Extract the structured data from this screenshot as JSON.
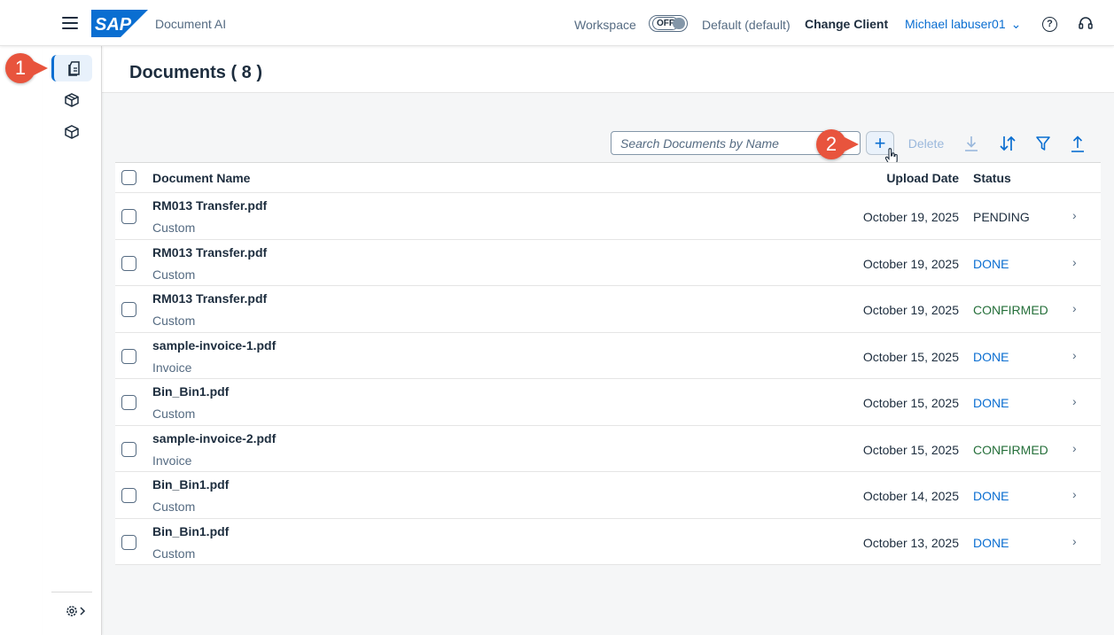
{
  "header": {
    "app_name": "Document AI",
    "workspace_label": "Workspace",
    "workspace_toggle": "OFF",
    "client_default": "Default (default)",
    "change_client": "Change Client",
    "user_name": "Michael labuser01",
    "logo_text": "SAP"
  },
  "sidenav": {
    "items": [
      {
        "name": "documents",
        "icon": "documents-icon",
        "active": true
      },
      {
        "name": "schemas",
        "icon": "cube-icon",
        "active": false
      },
      {
        "name": "templates",
        "icon": "cube-outline-icon",
        "active": false
      }
    ],
    "settings_icon": "gear-icon"
  },
  "page": {
    "title": "Documents ( 8 )"
  },
  "toolbar": {
    "search_placeholder": "Search Documents by Name",
    "add_label": "+",
    "delete_label": "Delete"
  },
  "table": {
    "headers": {
      "name": "Document Name",
      "date": "Upload Date",
      "status": "Status"
    },
    "rows": [
      {
        "name": "RM013 Transfer.pdf",
        "type": "Custom",
        "date": "October 19, 2025",
        "status": "PENDING"
      },
      {
        "name": "RM013 Transfer.pdf",
        "type": "Custom",
        "date": "October 19, 2025",
        "status": "DONE"
      },
      {
        "name": "RM013 Transfer.pdf",
        "type": "Custom",
        "date": "October 19, 2025",
        "status": "CONFIRMED"
      },
      {
        "name": "sample-invoice-1.pdf",
        "type": "Invoice",
        "date": "October 15, 2025",
        "status": "DONE"
      },
      {
        "name": "Bin_Bin1.pdf",
        "type": "Custom",
        "date": "October 15, 2025",
        "status": "DONE"
      },
      {
        "name": "sample-invoice-2.pdf",
        "type": "Invoice",
        "date": "October 15, 2025",
        "status": "CONFIRMED"
      },
      {
        "name": "Bin_Bin1.pdf",
        "type": "Custom",
        "date": "October 14, 2025",
        "status": "DONE"
      },
      {
        "name": "Bin_Bin1.pdf",
        "type": "Custom",
        "date": "October 13, 2025",
        "status": "DONE"
      }
    ]
  },
  "status_colors": {
    "PENDING": "#1d2d3e",
    "DONE": "#0a6ed1",
    "CONFIRMED": "#256f3a"
  },
  "callouts": {
    "one": "1",
    "two": "2"
  }
}
